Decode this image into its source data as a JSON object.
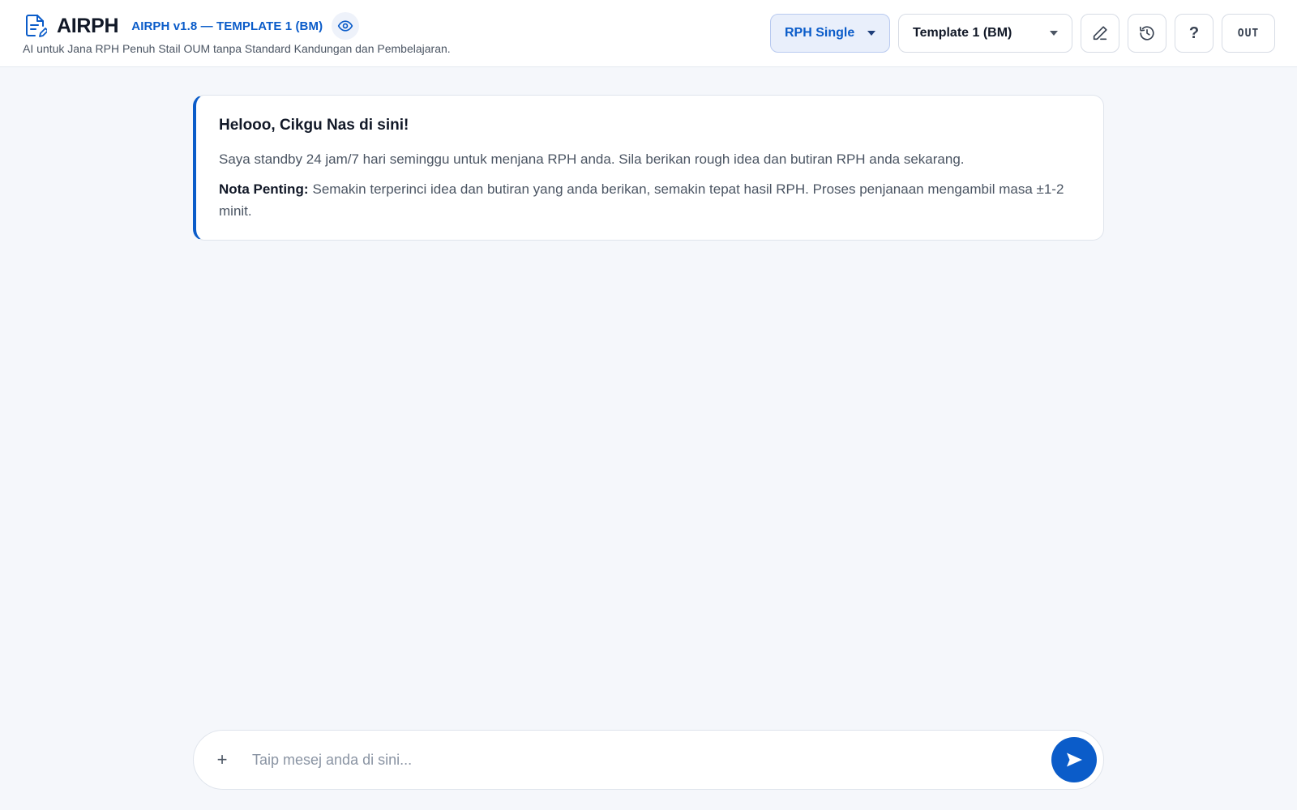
{
  "header": {
    "app_name": "AIRPH",
    "version_label": "AIRPH v1.8 — TEMPLATE 1 (BM)",
    "tagline": "AI untuk Jana RPH Penuh Stail OUM tanpa Standard Kandungan dan Pembelajaran.",
    "icons": {
      "logo": "document-edit-icon",
      "preview": "eye-icon"
    }
  },
  "controls": {
    "mode_select": {
      "value": "RPH Single"
    },
    "template_select": {
      "value": "Template 1 (BM)"
    },
    "edit_icon": "pencil-icon",
    "history_icon": "history-icon",
    "help_label": "?",
    "logout_label": "OUT"
  },
  "message": {
    "greeting": "Helooo, Cikgu Nas di sini!",
    "body": "Saya standby 24 jam/7 hari seminggu untuk menjana RPH anda. Sila berikan rough idea dan butiran RPH anda sekarang.",
    "note_label": "Nota Penting:",
    "note_text": "Semakin terperinci idea dan butiran yang anda berikan, semakin tepat hasil RPH. Proses penjanaan mengambil masa ±1-2 minit."
  },
  "composer": {
    "attach_label": "+",
    "placeholder": "Taip mesej anda di sini...",
    "value": "",
    "send_icon": "send-icon"
  },
  "colors": {
    "accent": "#0b5cc9",
    "background": "#f5f7fb",
    "card": "#ffffff",
    "mode_select_bg": "#e9effb"
  }
}
